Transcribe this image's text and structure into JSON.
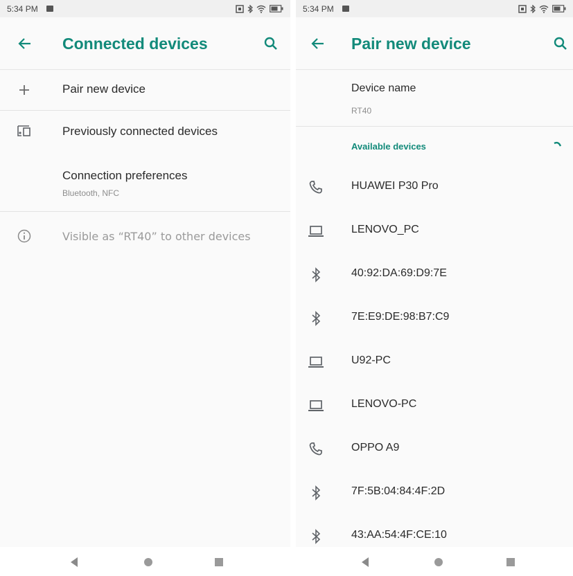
{
  "left": {
    "status": {
      "time": "5:34 PM"
    },
    "appbar": {
      "title": "Connected devices"
    },
    "items": {
      "pair": {
        "label": "Pair new device"
      },
      "previous": {
        "label": "Previously connected devices"
      },
      "prefs": {
        "label": "Connection preferences",
        "subtitle": "Bluetooth, NFC"
      }
    },
    "footer": {
      "visible_as": "Visible as “RT40” to other devices"
    }
  },
  "right": {
    "status": {
      "time": "5:34 PM"
    },
    "appbar": {
      "title": "Pair new device"
    },
    "device_name": {
      "label": "Device name",
      "value": "RT40"
    },
    "available": {
      "label": "Available devices"
    },
    "devices": [
      {
        "name": "HUAWEI P30 Pro",
        "icon": "phone-icon"
      },
      {
        "name": "LENOVO_PC",
        "icon": "laptop-icon"
      },
      {
        "name": "40:92:DA:69:D9:7E",
        "icon": "bluetooth-icon"
      },
      {
        "name": "7E:E9:DE:98:B7:C9",
        "icon": "bluetooth-icon"
      },
      {
        "name": "U92-PC",
        "icon": "laptop-icon"
      },
      {
        "name": "LENOVO-PC",
        "icon": "laptop-icon"
      },
      {
        "name": "OPPO A9",
        "icon": "phone-icon"
      },
      {
        "name": "7F:5B:04:84:4F:2D",
        "icon": "bluetooth-icon"
      },
      {
        "name": "43:AA:54:4F:CE:10",
        "icon": "bluetooth-icon"
      }
    ]
  },
  "colors": {
    "accent": "#128a7a",
    "text": "#2a2a2a",
    "secondary": "#8d8d8d",
    "icon": "#5f6368"
  }
}
